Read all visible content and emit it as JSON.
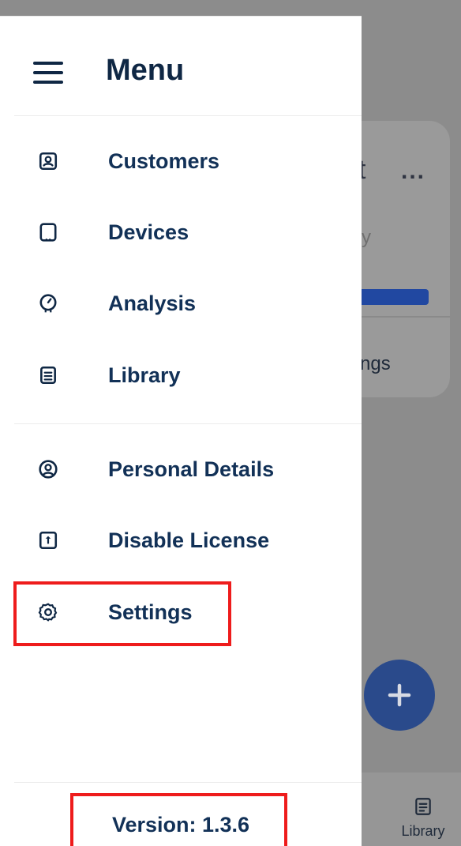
{
  "drawer": {
    "title": "Menu",
    "primary_items": [
      {
        "label": "Customers",
        "icon": "contact-card-icon"
      },
      {
        "label": "Devices",
        "icon": "tablet-device-icon"
      },
      {
        "label": "Analysis",
        "icon": "gauge-icon"
      },
      {
        "label": "Library",
        "icon": "document-list-icon"
      }
    ],
    "secondary_items": [
      {
        "label": "Personal Details",
        "icon": "user-circle-icon"
      },
      {
        "label": "Disable License",
        "icon": "license-key-icon"
      },
      {
        "label": "Settings",
        "icon": "gear-icon"
      }
    ],
    "version": "Version: 1.3.6"
  },
  "background": {
    "card_title": "t",
    "card_more": "...",
    "card_subtitle": "y",
    "card_link": "tings",
    "fab_icon": "plus-icon",
    "bottom_nav_library": "Library"
  },
  "colors": {
    "primary_text": "#123157",
    "accent_blue": "#2148a1",
    "highlight_red": "#ee1c1c",
    "scrim_gray": "#8c8c8c"
  }
}
